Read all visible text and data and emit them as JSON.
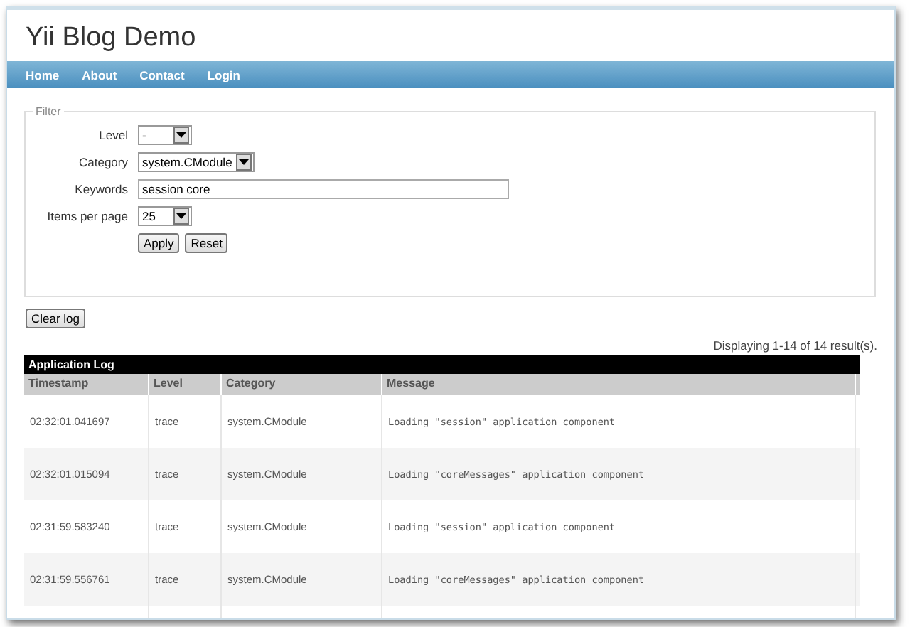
{
  "site_title": "Yii Blog Demo",
  "nav": [
    {
      "label": "Home"
    },
    {
      "label": "About"
    },
    {
      "label": "Contact"
    },
    {
      "label": "Login"
    }
  ],
  "filter": {
    "legend": "Filter",
    "fields": [
      {
        "kind": "select",
        "label": "Level",
        "value": "-"
      },
      {
        "kind": "select",
        "label": "Category",
        "value": "system.CModule"
      },
      {
        "kind": "text",
        "label": "Keywords",
        "value": "session core"
      },
      {
        "kind": "select",
        "label": "Items per page",
        "value": "25"
      }
    ],
    "buttons": [
      "Apply",
      "Reset"
    ]
  },
  "clear_button": "Clear log",
  "summary": "Displaying 1-14 of 14 result(s).",
  "table": {
    "title": "Application Log",
    "columns": [
      "Timestamp",
      "Level",
      "Category",
      "Message"
    ],
    "rows": [
      [
        "02:32:01.041697",
        "trace",
        "system.CModule",
        "Loading \"session\" application component"
      ],
      [
        "02:32:01.015094",
        "trace",
        "system.CModule",
        "Loading \"coreMessages\" application component"
      ],
      [
        "02:31:59.583240",
        "trace",
        "system.CModule",
        "Loading \"session\" application component"
      ],
      [
        "02:31:59.556761",
        "trace",
        "system.CModule",
        "Loading \"coreMessages\" application component"
      ]
    ]
  }
}
